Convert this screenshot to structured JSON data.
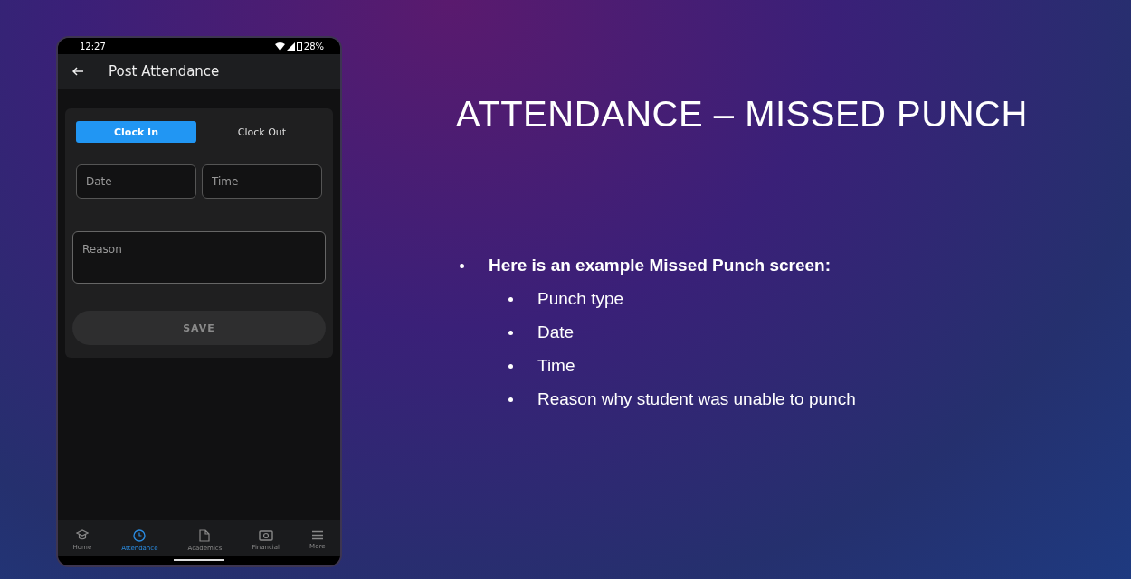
{
  "phone": {
    "status_bar": {
      "time": "12:27",
      "battery": "28%"
    },
    "app_bar": {
      "title": "Post Attendance"
    },
    "tabs": [
      {
        "label": "Clock In",
        "selected": true
      },
      {
        "label": "Clock Out",
        "selected": false
      }
    ],
    "fields": [
      {
        "placeholder": "Date"
      },
      {
        "placeholder": "Time"
      }
    ],
    "reason": {
      "placeholder": "Reason"
    },
    "save_button": {
      "label": "SAVE",
      "disabled": true
    },
    "bottom_nav": [
      {
        "label": "Home",
        "kind": "cap",
        "selected": false
      },
      {
        "label": "Attendance",
        "kind": "clock",
        "selected": true
      },
      {
        "label": "Academics",
        "kind": "doc",
        "selected": false
      },
      {
        "label": "Financial",
        "kind": "money",
        "selected": false
      },
      {
        "label": "More",
        "kind": "menu",
        "selected": false
      }
    ]
  },
  "slide": {
    "title": "ATTENDANCE – MISSED PUNCH",
    "bullets": [
      {
        "text": "Here is an example Missed Punch screen:",
        "children": [
          {
            "text": "Punch type"
          },
          {
            "text": "Date"
          },
          {
            "text": "Time"
          },
          {
            "text": "Reason why student was unable to punch"
          }
        ]
      }
    ]
  }
}
